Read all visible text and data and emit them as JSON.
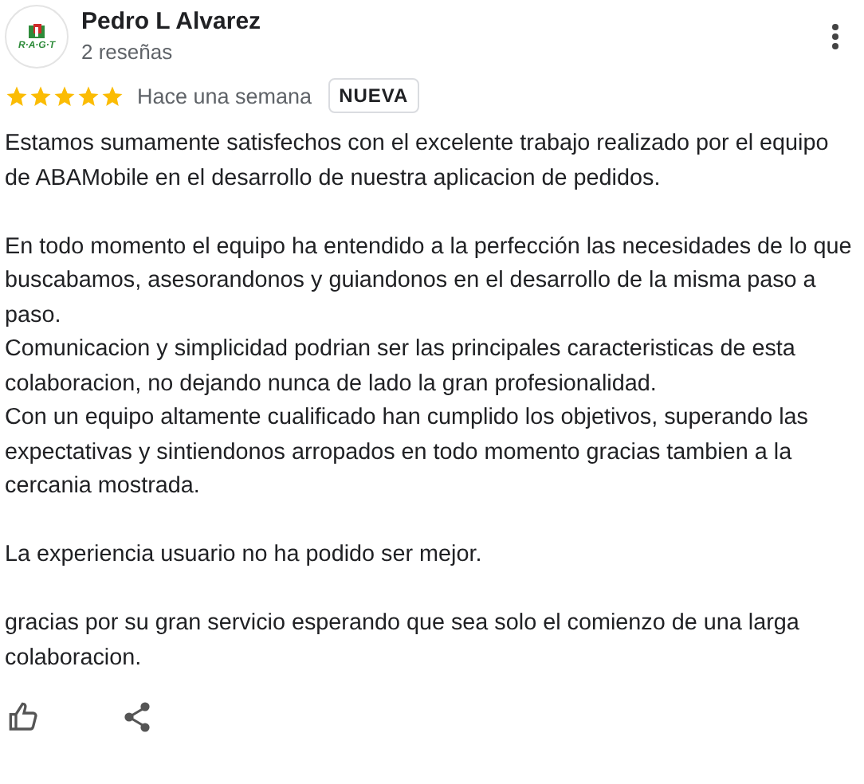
{
  "review": {
    "author": "Pedro L Alvarez",
    "avatar_text": "R·A·G·T",
    "review_count": "2 reseñas",
    "stars": 5,
    "date": "Hace una semana",
    "badge": "NUEVA",
    "body": [
      [
        "Estamos sumamente satisfechos con el excelente trabajo realizado por el equipo de ABAMobile en el desarrollo de nuestra aplicacion de pedidos."
      ],
      [
        "En todo momento el equipo ha entendido a la perfección las necesidades de lo que buscabamos, asesorandonos y guiandonos en el desarrollo de la misma paso a paso.",
        "Comunicacion y simplicidad podrian ser las principales caracteristicas de esta colaboracion, no dejando nunca de lado la gran profesionalidad.",
        "Con un equipo altamente cualificado han cumplido los objetivos, superando las expectativas y sintiendonos arropados en todo momento gracias tambien a la cercania mostrada."
      ],
      [
        "La experiencia usuario no ha podido ser mejor."
      ],
      [
        "gracias por su gran servicio esperando que sea solo el comienzo de una larga colaboracion."
      ]
    ]
  }
}
